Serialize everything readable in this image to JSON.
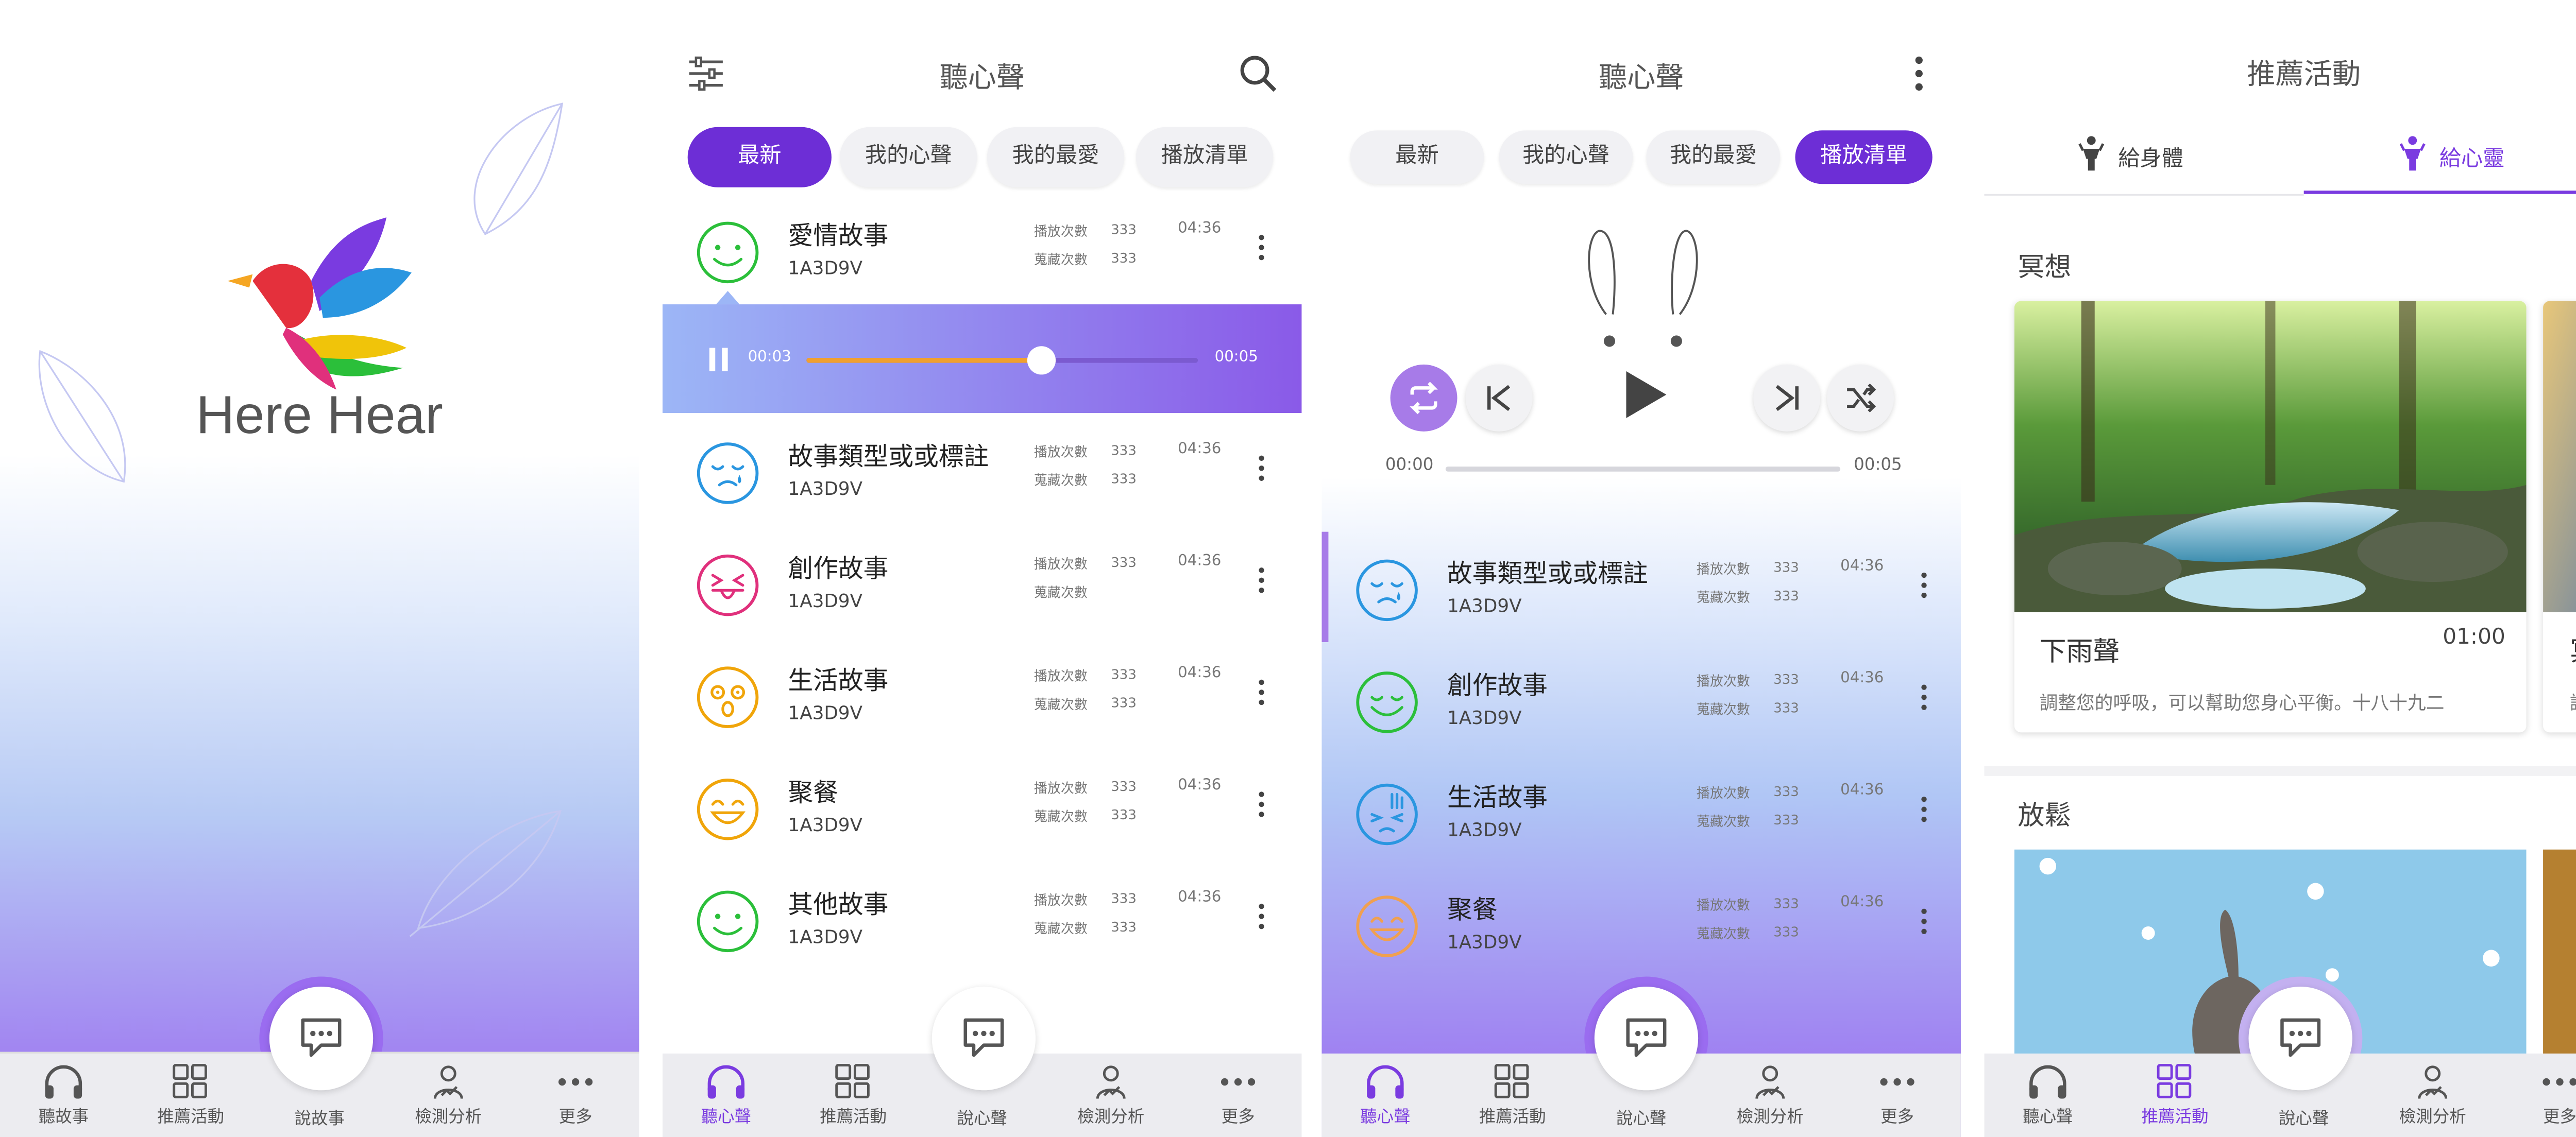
{
  "colors": {
    "accent": "#6d2ed6",
    "accent_light": "#9b6cf0",
    "bg_purple": "#9a6cf0"
  },
  "nav": {
    "s1": [
      "聽故事",
      "推薦活動",
      "說故事",
      "檢測分析",
      "更多"
    ],
    "s2": [
      "聽心聲",
      "推薦活動",
      "說心聲",
      "檢測分析",
      "更多"
    ]
  },
  "splash": {
    "logo_text": "Here Hear"
  },
  "listen": {
    "title": "聽心聲",
    "tabs": [
      "最新",
      "我的心聲",
      "我的最愛",
      "播放清單"
    ],
    "meta_plays": "播放次數",
    "meta_favs": "蒐藏次數",
    "player": {
      "current": "00:03",
      "total": "00:05",
      "progress": 0.6
    },
    "items": [
      {
        "title": "愛情故事",
        "id": "1A3D9V",
        "plays": "333",
        "favs": "333",
        "duration": "04:36",
        "face": "smile",
        "color": "#2bbf3a"
      },
      {
        "title": "故事類型或或標註",
        "id": "1A3D9V",
        "plays": "333",
        "favs": "333",
        "duration": "04:36",
        "face": "sad",
        "color": "#2a96e0"
      },
      {
        "title": "創作故事",
        "id": "1A3D9V",
        "plays": "333",
        "favs": "",
        "duration": "04:36",
        "face": "tongue",
        "color": "#e0307c"
      },
      {
        "title": "生活故事",
        "id": "1A3D9V",
        "plays": "333",
        "favs": "333",
        "duration": "04:36",
        "face": "shock",
        "color": "#f0a50a"
      },
      {
        "title": "聚餐",
        "id": "1A3D9V",
        "plays": "333",
        "favs": "333",
        "duration": "04:36",
        "face": "laugh",
        "color": "#f0a50a"
      },
      {
        "title": "其他故事",
        "id": "1A3D9V",
        "plays": "333",
        "favs": "333",
        "duration": "04:36",
        "face": "smile",
        "color": "#2bbf3a"
      }
    ]
  },
  "playlist": {
    "title": "聽心聲",
    "tabs": [
      "最新",
      "我的心聲",
      "我的最愛",
      "播放清單"
    ],
    "player": {
      "current": "00:00",
      "total": "00:05",
      "progress": 0.0
    },
    "items": [
      {
        "title": "故事類型或或標註",
        "id": "1A3D9V",
        "plays": "333",
        "favs": "333",
        "duration": "04:36",
        "face": "sad",
        "color": "#2a96e0"
      },
      {
        "title": "創作故事",
        "id": "1A3D9V",
        "plays": "333",
        "favs": "333",
        "duration": "04:36",
        "face": "grin",
        "color": "#2bbf3a"
      },
      {
        "title": "生活故事",
        "id": "1A3D9V",
        "plays": "333",
        "favs": "333",
        "duration": "04:36",
        "face": "cry",
        "color": "#2a96e0"
      },
      {
        "title": "聚餐",
        "id": "1A3D9V",
        "plays": "333",
        "favs": "333",
        "duration": "04:36",
        "face": "laugh",
        "color": "#f0a050"
      }
    ]
  },
  "activities": {
    "title": "推薦活動",
    "tabs": [
      "給身體",
      "給心靈"
    ],
    "sections": [
      {
        "heading": "冥想",
        "card_title": "下雨聲",
        "card_duration": "01:00",
        "card_desc": "調整您的呼吸，可以幫助您身心平衡。十八十九二",
        "peek_title": "冥想",
        "peek_desc": "調整您"
      },
      {
        "heading": "放鬆"
      }
    ]
  }
}
